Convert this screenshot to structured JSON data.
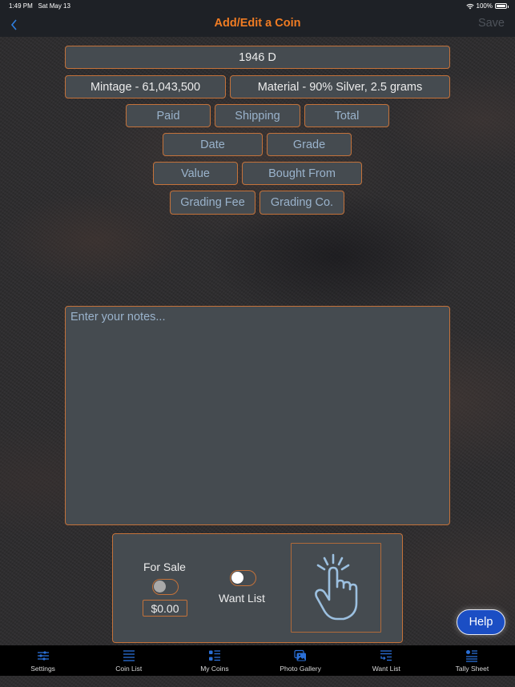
{
  "status_bar": {
    "time": "1:49 PM",
    "date": "Sat May 13",
    "battery": "100%",
    "battery_level": 1.0
  },
  "nav": {
    "title": "Add/Edit a Coin",
    "save_label": "Save"
  },
  "coin": {
    "name": "1946 D",
    "mintage": "Mintage - 61,043,500",
    "material": "Material - 90% Silver, 2.5 grams"
  },
  "fields": {
    "paid": "Paid",
    "shipping": "Shipping",
    "total": "Total",
    "date": "Date",
    "grade": "Grade",
    "value": "Value",
    "bought_from": "Bought From",
    "grading_fee": "Grading Fee",
    "grading_co": "Grading Co."
  },
  "notes": {
    "placeholder": "Enter your notes..."
  },
  "panel": {
    "for_sale_label": "For Sale",
    "for_sale_on": false,
    "price": "$0.00",
    "want_list_label": "Want List",
    "want_list_on": false
  },
  "help_label": "Help",
  "tabs": [
    {
      "label": "Settings",
      "icon": "sliders-icon"
    },
    {
      "label": "Coin List",
      "icon": "list-icon"
    },
    {
      "label": "My Coins",
      "icon": "bullet-list-icon"
    },
    {
      "label": "Photo Gallery",
      "icon": "photo-gallery-icon"
    },
    {
      "label": "Want List",
      "icon": "want-list-icon"
    },
    {
      "label": "Tally Sheet",
      "icon": "tally-sheet-icon"
    }
  ],
  "colors": {
    "accent_orange": "#f07c23",
    "border_orange": "#c4723a",
    "field_bg": "#454b50",
    "placeholder_blue": "#9ab3cc",
    "tab_icon_blue": "#2a6fd6",
    "help_blue": "#1b4ec4"
  }
}
